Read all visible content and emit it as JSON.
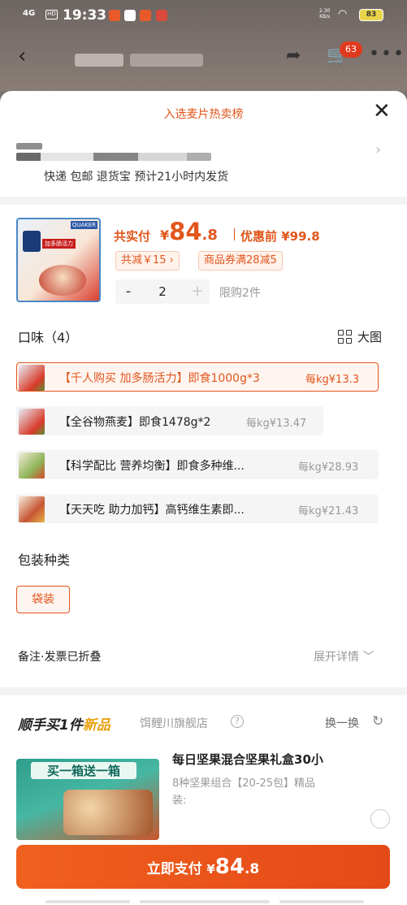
{
  "status_bar": {
    "signal": "4G",
    "hd": "HD",
    "time": "19:33",
    "net_speed": "2.30\nKB/s",
    "battery": "83",
    "colors": {
      "icon1": "#e85a2a",
      "icon2": "#ffffff",
      "icon3": "#e85a2a"
    }
  },
  "nav": {
    "back_icon": "‹",
    "share_icon": "➦",
    "cart_icon": "🛒",
    "cart_count": "63",
    "more_icon": "•••"
  },
  "sheet": {
    "title": "入选麦片热卖榜",
    "close_icon": "✕",
    "address_chevron": "›",
    "shipping": "快递 包邮 退货宝 预计21小时内发货"
  },
  "product": {
    "image": {
      "brand": "QUAKER",
      "tag": "加多肠活力"
    },
    "pay_label": "共实付",
    "currency": "¥",
    "price_int": "84",
    "price_dec": ".8",
    "before_label": "优惠前 ¥99.8",
    "discount_chip": "共减￥15 ›",
    "coupon_chip": "商品券满28减5",
    "stepper": {
      "minus": "-",
      "value": "2",
      "plus": "+"
    },
    "limit": "限购2件"
  },
  "flavor": {
    "title": "口味（4）",
    "big_view": "大图",
    "options": [
      {
        "text": "【千人购买 加多肠活力】即食1000g*3",
        "unit": "每kg¥13.3",
        "selected": true
      },
      {
        "text": "【全谷物燕麦】即食1478g*2",
        "unit": "每kg¥13.47",
        "selected": false
      },
      {
        "text": "【科学配比 营养均衡】即食多种维...",
        "unit": "每kg¥28.93",
        "selected": false
      },
      {
        "text": "【天天吃 助力加钙】高钙维生素即...",
        "unit": "每kg¥21.43",
        "selected": false
      }
    ]
  },
  "packaging": {
    "title": "包装种类",
    "option": "袋装"
  },
  "note": {
    "label": "备注·发票已折叠",
    "expand": "展开详情 ﹀"
  },
  "extra": {
    "title_prefix": "顺手买1件",
    "title_new": "新品",
    "shop": "饵鲤川旗舰店",
    "help_icon": "?",
    "swap": "换一换",
    "swap_icon": "↻",
    "image_text": "买一箱送一箱",
    "name": "每日坚果混合坚果礼盒30小",
    "desc": "8种坚果组合【20-25包】精品装:"
  },
  "pay_button": {
    "label": "立即支付",
    "currency": "¥",
    "int": "84",
    "dec": ".8"
  },
  "colors": {
    "accent": "#e2561c",
    "new_badge": "#e8a10c"
  }
}
